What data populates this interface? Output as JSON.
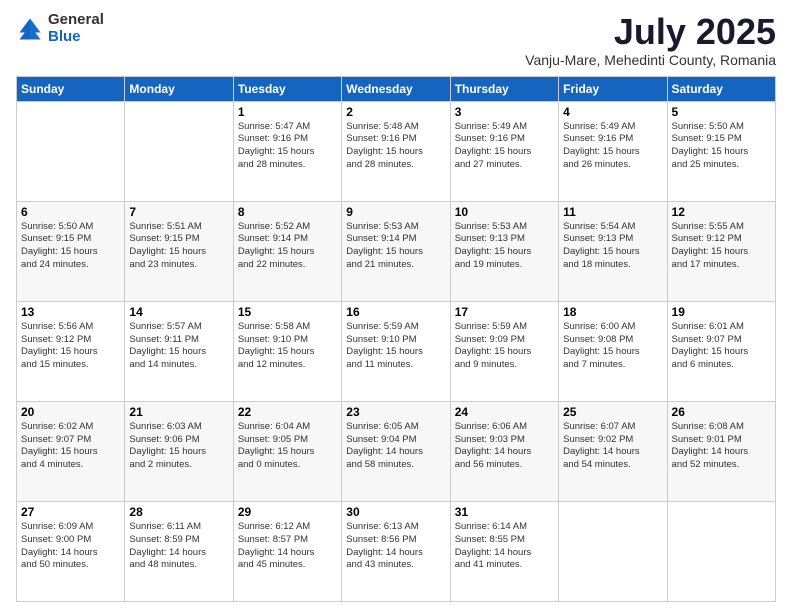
{
  "logo": {
    "general": "General",
    "blue": "Blue"
  },
  "header": {
    "title": "July 2025",
    "subtitle": "Vanju-Mare, Mehedinti County, Romania"
  },
  "weekdays": [
    "Sunday",
    "Monday",
    "Tuesday",
    "Wednesday",
    "Thursday",
    "Friday",
    "Saturday"
  ],
  "weeks": [
    [
      {
        "day": "",
        "info": ""
      },
      {
        "day": "",
        "info": ""
      },
      {
        "day": "1",
        "info": "Sunrise: 5:47 AM\nSunset: 9:16 PM\nDaylight: 15 hours\nand 28 minutes."
      },
      {
        "day": "2",
        "info": "Sunrise: 5:48 AM\nSunset: 9:16 PM\nDaylight: 15 hours\nand 28 minutes."
      },
      {
        "day": "3",
        "info": "Sunrise: 5:49 AM\nSunset: 9:16 PM\nDaylight: 15 hours\nand 27 minutes."
      },
      {
        "day": "4",
        "info": "Sunrise: 5:49 AM\nSunset: 9:16 PM\nDaylight: 15 hours\nand 26 minutes."
      },
      {
        "day": "5",
        "info": "Sunrise: 5:50 AM\nSunset: 9:15 PM\nDaylight: 15 hours\nand 25 minutes."
      }
    ],
    [
      {
        "day": "6",
        "info": "Sunrise: 5:50 AM\nSunset: 9:15 PM\nDaylight: 15 hours\nand 24 minutes."
      },
      {
        "day": "7",
        "info": "Sunrise: 5:51 AM\nSunset: 9:15 PM\nDaylight: 15 hours\nand 23 minutes."
      },
      {
        "day": "8",
        "info": "Sunrise: 5:52 AM\nSunset: 9:14 PM\nDaylight: 15 hours\nand 22 minutes."
      },
      {
        "day": "9",
        "info": "Sunrise: 5:53 AM\nSunset: 9:14 PM\nDaylight: 15 hours\nand 21 minutes."
      },
      {
        "day": "10",
        "info": "Sunrise: 5:53 AM\nSunset: 9:13 PM\nDaylight: 15 hours\nand 19 minutes."
      },
      {
        "day": "11",
        "info": "Sunrise: 5:54 AM\nSunset: 9:13 PM\nDaylight: 15 hours\nand 18 minutes."
      },
      {
        "day": "12",
        "info": "Sunrise: 5:55 AM\nSunset: 9:12 PM\nDaylight: 15 hours\nand 17 minutes."
      }
    ],
    [
      {
        "day": "13",
        "info": "Sunrise: 5:56 AM\nSunset: 9:12 PM\nDaylight: 15 hours\nand 15 minutes."
      },
      {
        "day": "14",
        "info": "Sunrise: 5:57 AM\nSunset: 9:11 PM\nDaylight: 15 hours\nand 14 minutes."
      },
      {
        "day": "15",
        "info": "Sunrise: 5:58 AM\nSunset: 9:10 PM\nDaylight: 15 hours\nand 12 minutes."
      },
      {
        "day": "16",
        "info": "Sunrise: 5:59 AM\nSunset: 9:10 PM\nDaylight: 15 hours\nand 11 minutes."
      },
      {
        "day": "17",
        "info": "Sunrise: 5:59 AM\nSunset: 9:09 PM\nDaylight: 15 hours\nand 9 minutes."
      },
      {
        "day": "18",
        "info": "Sunrise: 6:00 AM\nSunset: 9:08 PM\nDaylight: 15 hours\nand 7 minutes."
      },
      {
        "day": "19",
        "info": "Sunrise: 6:01 AM\nSunset: 9:07 PM\nDaylight: 15 hours\nand 6 minutes."
      }
    ],
    [
      {
        "day": "20",
        "info": "Sunrise: 6:02 AM\nSunset: 9:07 PM\nDaylight: 15 hours\nand 4 minutes."
      },
      {
        "day": "21",
        "info": "Sunrise: 6:03 AM\nSunset: 9:06 PM\nDaylight: 15 hours\nand 2 minutes."
      },
      {
        "day": "22",
        "info": "Sunrise: 6:04 AM\nSunset: 9:05 PM\nDaylight: 15 hours\nand 0 minutes."
      },
      {
        "day": "23",
        "info": "Sunrise: 6:05 AM\nSunset: 9:04 PM\nDaylight: 14 hours\nand 58 minutes."
      },
      {
        "day": "24",
        "info": "Sunrise: 6:06 AM\nSunset: 9:03 PM\nDaylight: 14 hours\nand 56 minutes."
      },
      {
        "day": "25",
        "info": "Sunrise: 6:07 AM\nSunset: 9:02 PM\nDaylight: 14 hours\nand 54 minutes."
      },
      {
        "day": "26",
        "info": "Sunrise: 6:08 AM\nSunset: 9:01 PM\nDaylight: 14 hours\nand 52 minutes."
      }
    ],
    [
      {
        "day": "27",
        "info": "Sunrise: 6:09 AM\nSunset: 9:00 PM\nDaylight: 14 hours\nand 50 minutes."
      },
      {
        "day": "28",
        "info": "Sunrise: 6:11 AM\nSunset: 8:59 PM\nDaylight: 14 hours\nand 48 minutes."
      },
      {
        "day": "29",
        "info": "Sunrise: 6:12 AM\nSunset: 8:57 PM\nDaylight: 14 hours\nand 45 minutes."
      },
      {
        "day": "30",
        "info": "Sunrise: 6:13 AM\nSunset: 8:56 PM\nDaylight: 14 hours\nand 43 minutes."
      },
      {
        "day": "31",
        "info": "Sunrise: 6:14 AM\nSunset: 8:55 PM\nDaylight: 14 hours\nand 41 minutes."
      },
      {
        "day": "",
        "info": ""
      },
      {
        "day": "",
        "info": ""
      }
    ]
  ]
}
